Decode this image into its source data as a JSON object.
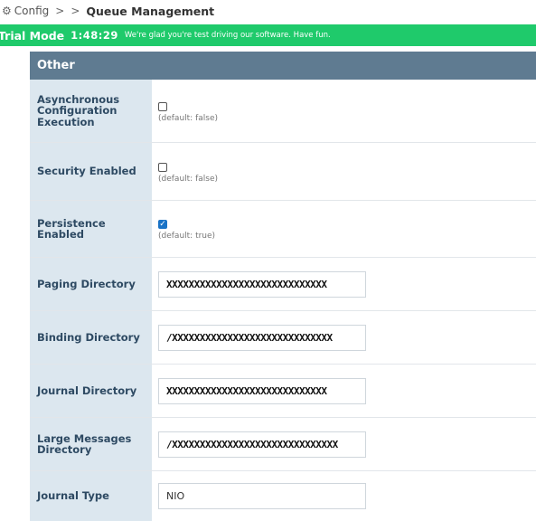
{
  "breadcrumb": {
    "root": "Config",
    "separator": ">",
    "current": "Queue Management"
  },
  "trial": {
    "mode_label": "Trial Mode",
    "timer": "1:48:29",
    "message": "We're glad you're test driving our software. Have fun."
  },
  "panel": {
    "title": "Other",
    "rows": [
      {
        "label": "Asynchronous Configuration Execution",
        "checked": false,
        "default": "(default: false)"
      },
      {
        "label": "Security Enabled",
        "checked": false,
        "default": "(default: false)"
      },
      {
        "label": "Persistence Enabled",
        "checked": true,
        "default": "(default: true)"
      },
      {
        "label": "Paging Directory",
        "value": "XXXXXXXXXXXXXXXXXXXXXXXXXXXXX"
      },
      {
        "label": "Binding Directory",
        "value": "/XXXXXXXXXXXXXXXXXXXXXXXXXXXXX"
      },
      {
        "label": "Journal Directory",
        "value": "XXXXXXXXXXXXXXXXXXXXXXXXXXXXX"
      },
      {
        "label": "Large Messages Directory",
        "value": "/XXXXXXXXXXXXXXXXXXXXXXXXXXXXXX"
      },
      {
        "label": "Journal Type",
        "value": "NIO"
      }
    ]
  },
  "colors": {
    "trial_bar": "#1fca6b",
    "panel_header": "#5f7b91",
    "label_bg": "#dce7ef",
    "checkbox_checked": "#1a73c6"
  }
}
